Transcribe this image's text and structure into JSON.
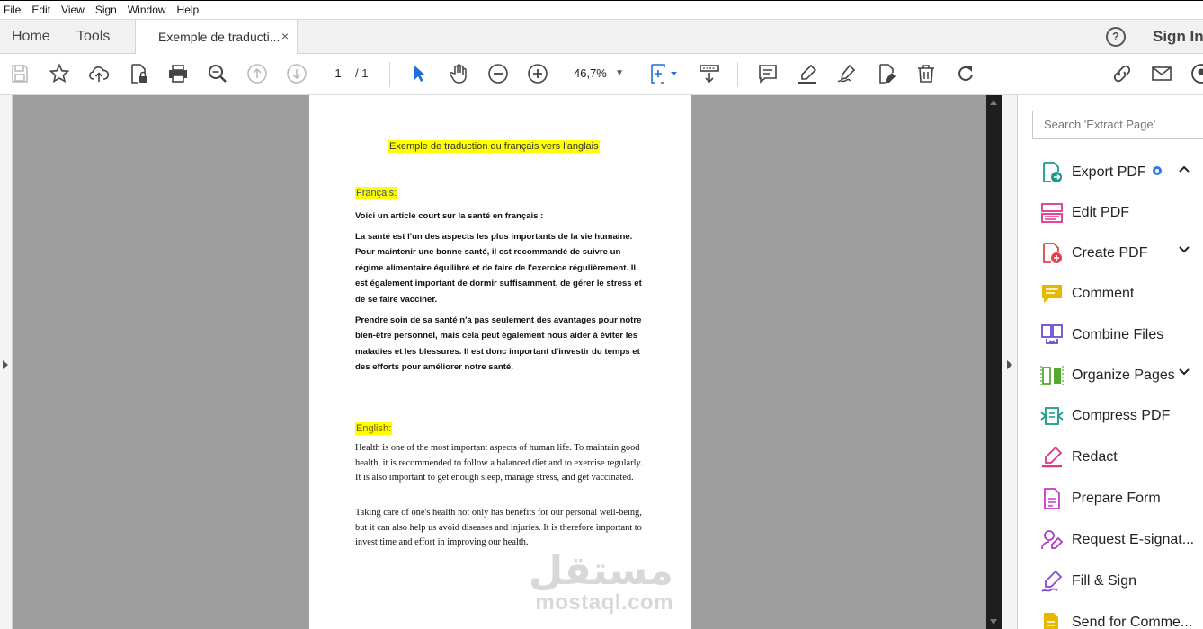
{
  "menu": [
    "File",
    "Edit",
    "View",
    "Sign",
    "Window",
    "Help"
  ],
  "tabs": {
    "home": "Home",
    "tools": "Tools",
    "doc": "Exemple de traducti...",
    "close": "×",
    "signin": "Sign In",
    "help": "?"
  },
  "toolbar": {
    "page_current": "1",
    "page_total": "/ 1",
    "zoom": "46,7%"
  },
  "document": {
    "title": "Exemple de traduction du français vers l'anglais",
    "fr_heading": "Français:",
    "fr_intro": "Voici un article court sur la santé en français :",
    "fr_p1": "La santé est l'un des aspects les plus importants de la vie humaine. Pour maintenir une bonne santé, il est recommandé de suivre un régime alimentaire équilibré et de faire de l'exercice régulièrement. Il est également important de dormir suffisamment, de gérer le stress et de se faire vacciner.",
    "fr_p2": "Prendre soin de sa santé n'a pas seulement des avantages pour notre bien-être personnel, mais cela peut également nous aider à éviter les maladies et les blessures. Il est donc important d'investir du temps et des efforts pour améliorer notre santé.",
    "en_heading": "English:",
    "en_p1": "Health is one of the most important aspects of human life. To maintain good health, it is recommended to follow a balanced diet and to exercise regularly. It is also important to get enough sleep, manage stress, and get vaccinated.",
    "en_p2": "Taking care of one's health not only has benefits for our personal well-being, but it can also help us avoid diseases and injuries. It is therefore important to invest time and effort in improving our health.",
    "watermark_ar": "مستقل",
    "watermark_en": "mostaql.com"
  },
  "tools_pane": {
    "search_placeholder": "Search 'Extract Page'",
    "items": [
      {
        "label": "Export PDF",
        "icon": "export-pdf-icon",
        "color": "#1a9a8a"
      },
      {
        "label": "Edit PDF",
        "icon": "edit-pdf-icon",
        "color": "#e0338a"
      },
      {
        "label": "Create PDF",
        "icon": "create-pdf-icon",
        "color": "#e0444a"
      },
      {
        "label": "Comment",
        "icon": "comment-icon",
        "color": "#e6b800"
      },
      {
        "label": "Combine Files",
        "icon": "combine-files-icon",
        "color": "#6a4bd8"
      },
      {
        "label": "Organize Pages",
        "icon": "organize-pages-icon",
        "color": "#55a832"
      },
      {
        "label": "Compress PDF",
        "icon": "compress-pdf-icon",
        "color": "#1a9a8a"
      },
      {
        "label": "Redact",
        "icon": "redact-icon",
        "color": "#e0338a"
      },
      {
        "label": "Prepare Form",
        "icon": "prepare-form-icon",
        "color": "#c838c8"
      },
      {
        "label": "Request E-signat...",
        "icon": "request-esign-icon",
        "color": "#b038c8"
      },
      {
        "label": "Fill & Sign",
        "icon": "fill-sign-icon",
        "color": "#8a48d8"
      },
      {
        "label": "Send for Comme...",
        "icon": "send-comment-icon",
        "color": "#e6b800"
      }
    ]
  }
}
